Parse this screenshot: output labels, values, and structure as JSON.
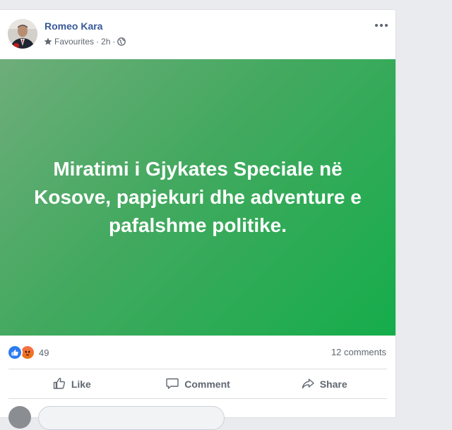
{
  "post": {
    "author": "Romeo Kara",
    "audience": "Favourites",
    "separator": "·",
    "time": "2h",
    "text": "Miratimi i Gjykates Speciale në Kosove, papjekuri dhe adventure e pafalshme politike.",
    "reaction_count": "49",
    "comments": "12 comments",
    "reaction_icons": [
      "like-reaction-icon",
      "angry-reaction-icon"
    ],
    "banner_colors": [
      "#6ead7a",
      "#15ad4b"
    ]
  },
  "actions": {
    "like": "Like",
    "comment": "Comment",
    "share": "Share"
  },
  "colors": {
    "author": "#385898",
    "meta": "#606770"
  }
}
